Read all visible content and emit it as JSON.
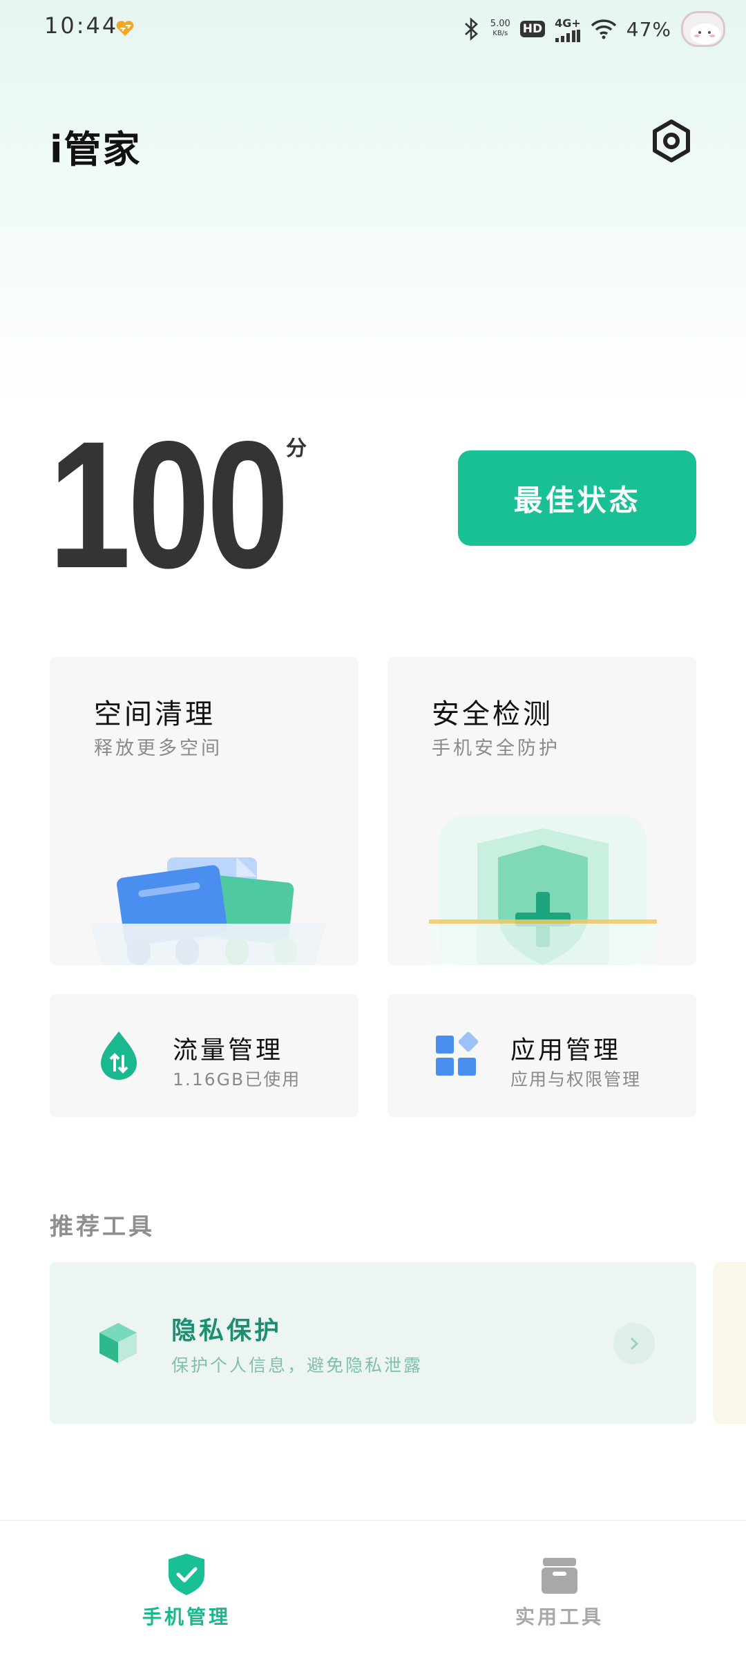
{
  "status_bar": {
    "time": "10:44",
    "net_speed_value": "5.00",
    "net_speed_unit": "KB/s",
    "hd_label": "HD",
    "network_label": "4G+",
    "battery": "47%",
    "icons": [
      "heart-notification-icon",
      "bluetooth-icon",
      "signal-icon",
      "wifi-icon",
      "avatar"
    ]
  },
  "header": {
    "title": "i管家",
    "settings_icon": "settings-icon"
  },
  "score": {
    "value": "100",
    "unit": "分",
    "status_button": "最佳状态"
  },
  "cards": {
    "space_clean": {
      "title": "空间清理",
      "subtitle": "释放更多空间"
    },
    "security_check": {
      "title": "安全检测",
      "subtitle": "手机安全防护"
    },
    "data_usage": {
      "title": "流量管理",
      "subtitle": "1.16GB已使用"
    },
    "app_manage": {
      "title": "应用管理",
      "subtitle": "应用与权限管理"
    }
  },
  "recommended": {
    "section_title": "推荐工具",
    "items": [
      {
        "title": "隐私保护",
        "subtitle": "保护个人信息，避免隐私泄露"
      }
    ]
  },
  "bottom_nav": {
    "items": [
      {
        "label": "手机管理",
        "active": true
      },
      {
        "label": "实用工具",
        "active": false
      }
    ]
  },
  "colors": {
    "accent": "#19c096",
    "title_green": "#1c8f72",
    "blue": "#4a8ef0",
    "inactive": "#a8a8a8"
  }
}
